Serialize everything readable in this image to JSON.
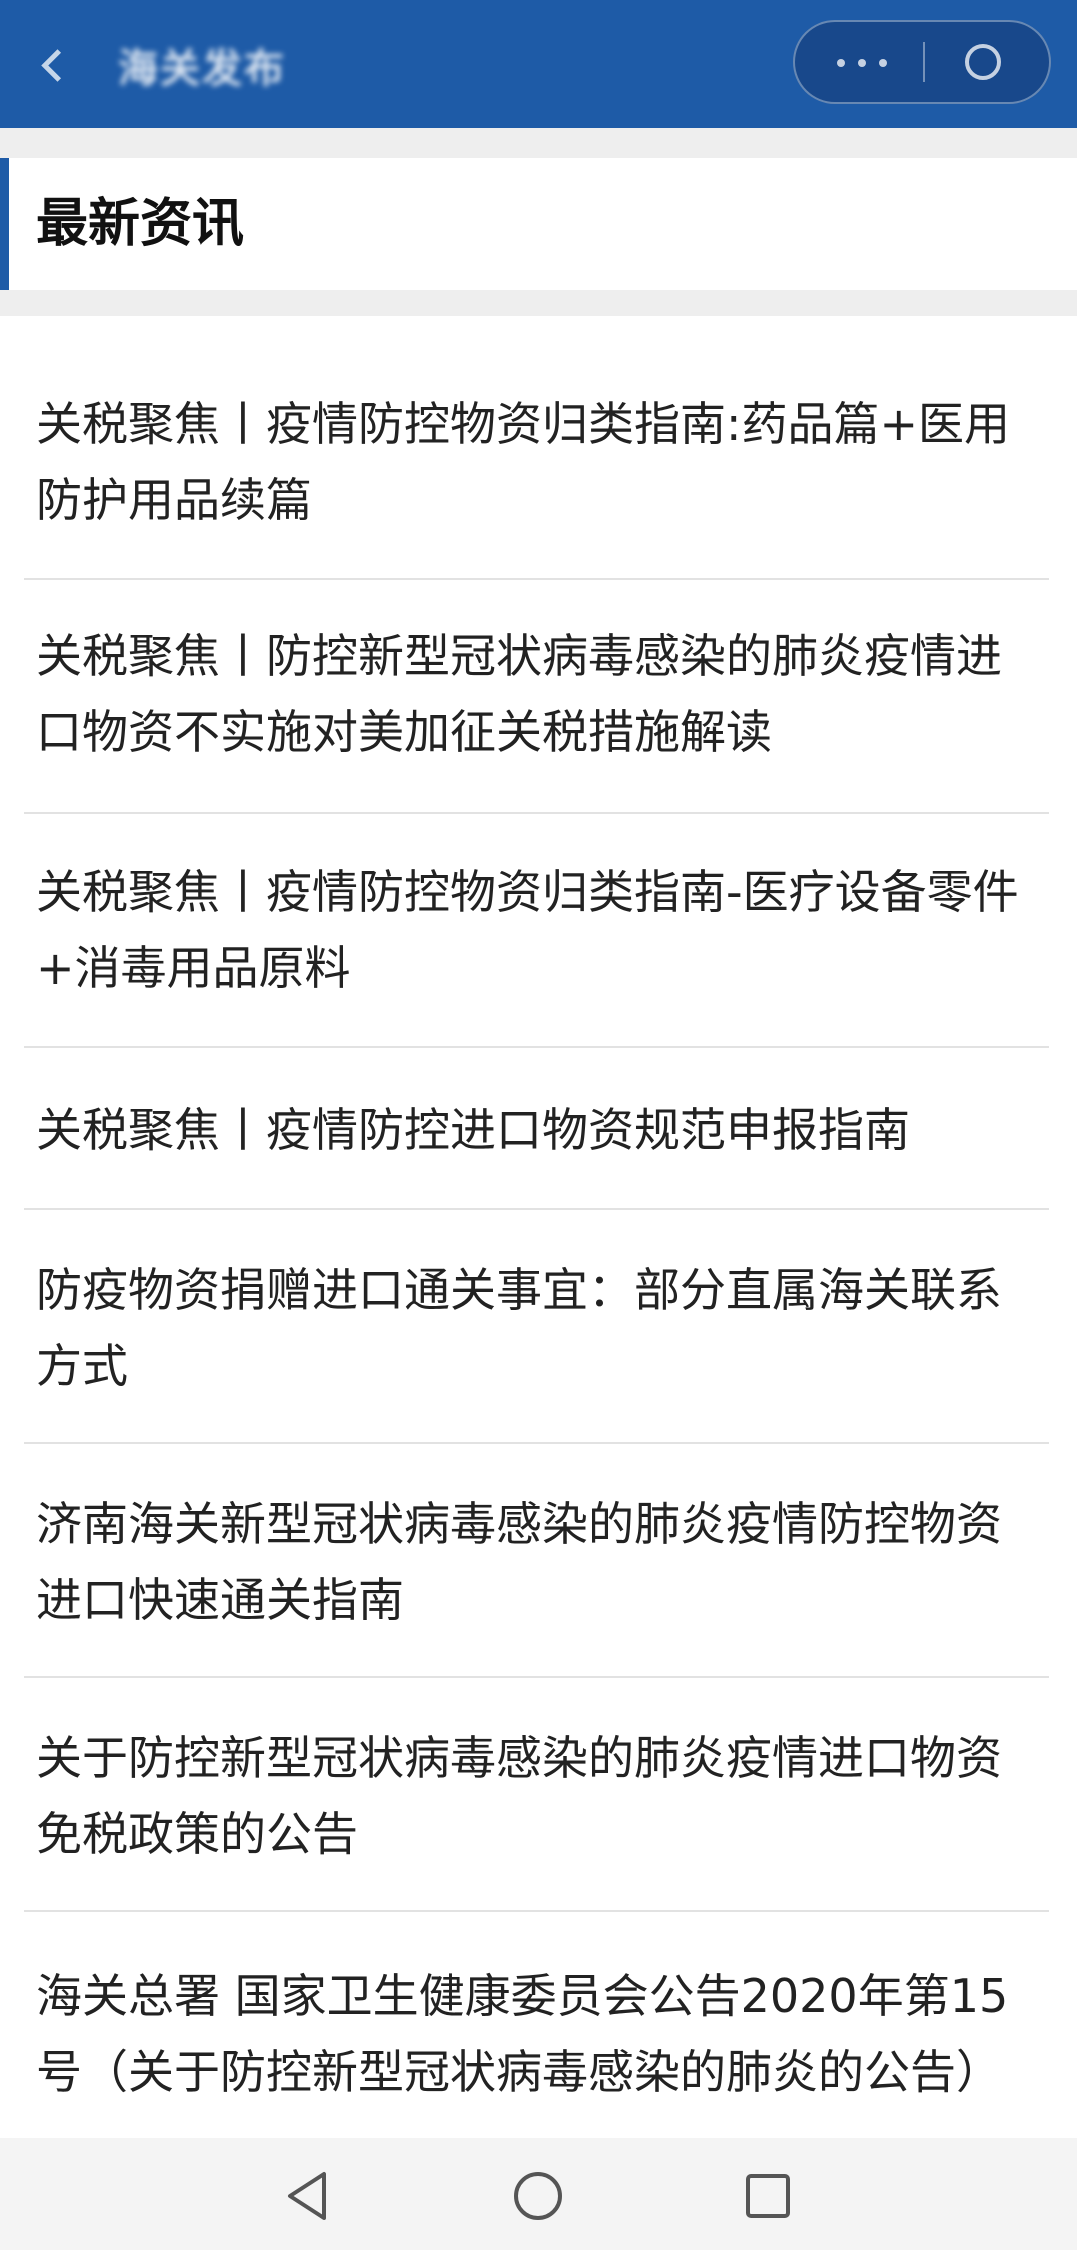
{
  "header": {
    "title": "海关发布",
    "back_icon": "back-arrow-icon",
    "more_icon": "more-icon",
    "close_icon": "close-icon",
    "accent_color": "#1e5ba7"
  },
  "section": {
    "title": "最新资讯"
  },
  "news": [
    {
      "title": "关税聚焦丨疫情防控物资归类指南:药品篇+医用防护用品续篇"
    },
    {
      "title": "关税聚焦丨防控新型冠状病毒感染的肺炎疫情进口物资不实施对美加征关税措施解读"
    },
    {
      "title": "关税聚焦丨疫情防控物资归类指南-医疗设备零件+消毒用品原料"
    },
    {
      "title": "关税聚焦丨疫情防控进口物资规范申报指南"
    },
    {
      "title": "防疫物资捐赠进口通关事宜：部分直属海关联系方式"
    },
    {
      "title": "济南海关新型冠状病毒感染的肺炎疫情防控物资进口快速通关指南"
    },
    {
      "title": "关于防控新型冠状病毒感染的肺炎疫情进口物资免税政策的公告"
    },
    {
      "title": "海关总署 国家卫生健康委员会公告2020年第15号（关于防控新型冠状病毒感染的肺炎的公告）"
    }
  ],
  "navbar": {
    "back_icon": "triangle-back-icon",
    "home_icon": "circle-home-icon",
    "recents_icon": "square-recents-icon"
  }
}
